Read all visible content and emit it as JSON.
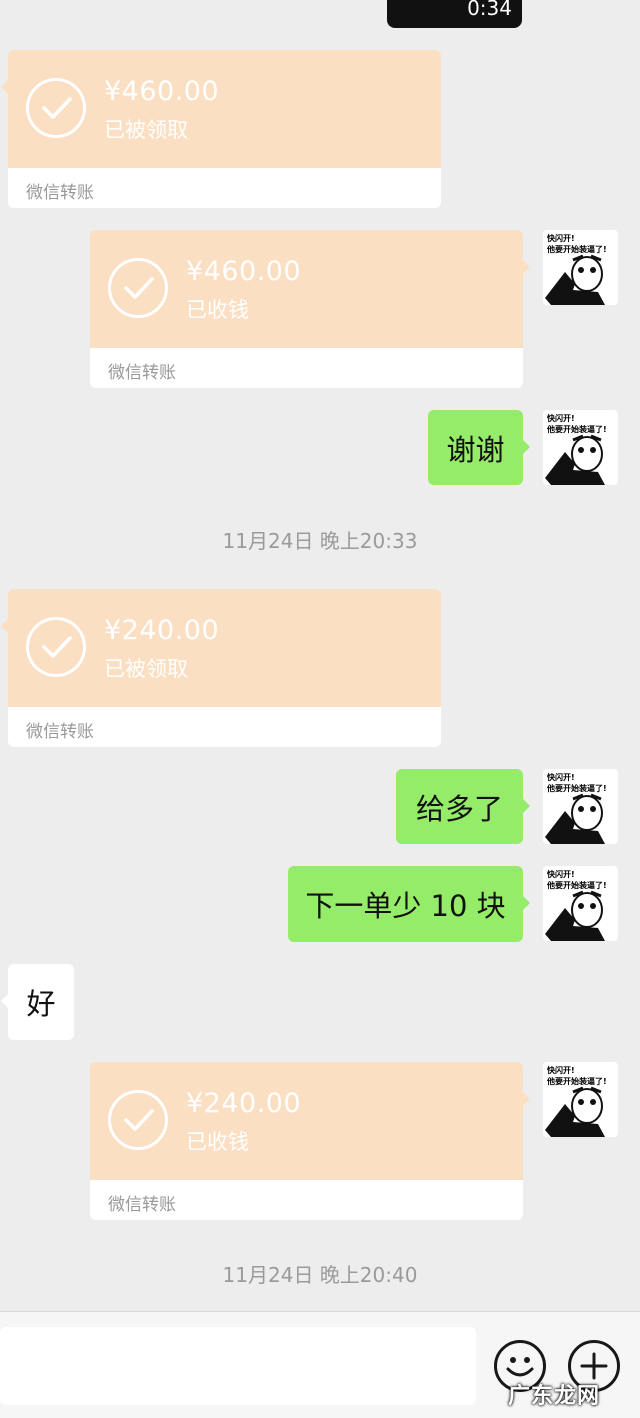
{
  "top_partial": {
    "text": "0:34"
  },
  "messages": {
    "transfer1": {
      "amount": "¥460.00",
      "status": "已被领取",
      "label": "微信转账"
    },
    "transfer2": {
      "amount": "¥460.00",
      "status": "已收钱",
      "label": "微信转账"
    },
    "msg_thanks": {
      "text": "谢谢"
    },
    "time1": {
      "text": "11月24日 晚上20:33"
    },
    "transfer3": {
      "amount": "¥240.00",
      "status": "已被领取",
      "label": "微信转账"
    },
    "msg_overpaid": {
      "text": "给多了"
    },
    "msg_discount": {
      "text": "下一单少 10 块"
    },
    "msg_ok": {
      "text": "好"
    },
    "transfer4": {
      "amount": "¥240.00",
      "status": "已收钱",
      "label": "微信转账"
    },
    "time2": {
      "text": "11月24日 晚上20:40"
    }
  },
  "avatar": {
    "caption_line1": "快闪开!",
    "caption_line2": "他要开始装逼了!"
  },
  "input_bar": {
    "emoji_icon": "emoji-face-icon",
    "plus_icon": "plus-icon"
  },
  "watermark": {
    "text": "广东龙网"
  },
  "colors": {
    "transfer_bg": "#fbdfc3",
    "sent_bubble": "#95ec69",
    "chat_bg": "#ededed"
  }
}
